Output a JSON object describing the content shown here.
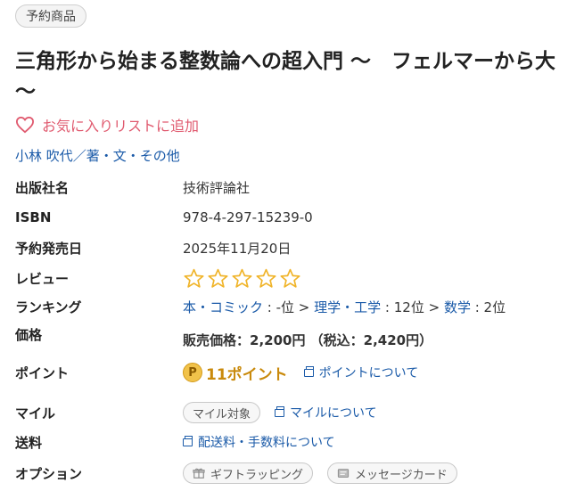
{
  "badge": "予約商品",
  "title": {
    "line1": "三角形から始まる整数論への超入門 ～　フェルマーから大",
    "line2": "～"
  },
  "favorite": {
    "label": "お気に入りリストに追加",
    "icon": "heart-outline-icon"
  },
  "author": "小林 吹代／著・文・その他",
  "rows": {
    "publisher": {
      "label": "出版社名",
      "value": "技術評論社"
    },
    "isbn": {
      "label": "ISBN",
      "value": "978-4-297-15239-0"
    },
    "release": {
      "label": "予約発売日",
      "value": "2025年11月20日"
    },
    "review": {
      "label": "レビュー",
      "stars_filled": 0,
      "stars_total": 5
    },
    "ranking": {
      "label": "ランキング",
      "cat1": "本・コミック",
      "rank1": " : -位 > ",
      "cat2": "理学・工学",
      "rank2": " : 12位 > ",
      "cat3": "数学",
      "rank3": " : 2位"
    },
    "price": {
      "label": "価格",
      "text": "販売価格：2,200円 （税込：2,420円）"
    },
    "point": {
      "label": "ポイント",
      "coin": "P",
      "value": "11ポイント",
      "link": "ポイントについて"
    },
    "mile": {
      "label": "マイル",
      "pill": "マイル対象",
      "link": "マイルについて"
    },
    "shipping": {
      "label": "送料",
      "link": "配送料・手数料について"
    },
    "option": {
      "label": "オプション",
      "gift": "ギフトラッピング",
      "message": "メッセージカード"
    }
  },
  "colors": {
    "link": "#1a5aa8",
    "favorite": "#e05a6f",
    "point": "#c98a0c",
    "star": "#f0b429"
  }
}
